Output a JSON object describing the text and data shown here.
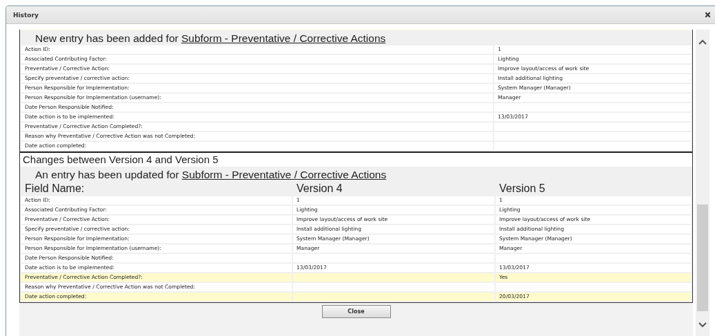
{
  "window": {
    "title": "History"
  },
  "sections": [
    {
      "kind": "added",
      "heading_prefix": "New entry has been added for ",
      "heading_link": "Subform - Preventative / Corrective Actions",
      "rows": [
        {
          "label": "Action ID:",
          "value": "1"
        },
        {
          "label": "Associated Contributing Factor:",
          "value": "Lighting"
        },
        {
          "label": "Preventative / Corrective Action:",
          "value": "Improve layout/access of work site"
        },
        {
          "label": "Specify preventative / corrective action:",
          "value": "Install additional lighting"
        },
        {
          "label": "Person Responsible for Implementation:",
          "value": "System Manager (Manager)"
        },
        {
          "label": "Person Responsible for Implementation (username):",
          "value": "Manager"
        },
        {
          "label": "Date Person Responsible Notified:",
          "value": ""
        },
        {
          "label": "Date action is to be implemented:",
          "value": "13/03/2017"
        },
        {
          "label": "Preventative / Corrective Action Completed?:",
          "value": ""
        },
        {
          "label": "Reason why Preventative / Corrective Action was not Completed:",
          "value": ""
        },
        {
          "label": "Date action completed:",
          "value": ""
        }
      ]
    },
    {
      "kind": "changes",
      "title": "Changes between Version 4 and Version 5",
      "heading_prefix": "An entry has been updated for ",
      "heading_link": "Subform - Preventative / Corrective Actions",
      "columns": [
        "Field Name:",
        "Version 4",
        "Version 5"
      ],
      "rows": [
        {
          "label": "Action ID:",
          "old": "1",
          "new": "1",
          "changed": false
        },
        {
          "label": "Associated Contributing Factor:",
          "old": "Lighting",
          "new": "Lighting",
          "changed": false
        },
        {
          "label": "Preventative / Corrective Action:",
          "old": "Improve layout/access of work site",
          "new": "Improve layout/access of work site",
          "changed": false
        },
        {
          "label": "Specify preventative / corrective action:",
          "old": "Install additional lighting",
          "new": "Install additional lighting",
          "changed": false
        },
        {
          "label": "Person Responsible for Implementation:",
          "old": "System Manager (Manager)",
          "new": "System Manager (Manager)",
          "changed": false
        },
        {
          "label": "Person Responsible for Implementation (username):",
          "old": "Manager",
          "new": "Manager",
          "changed": false
        },
        {
          "label": "Date Person Responsible Notified:",
          "old": "",
          "new": "",
          "changed": false
        },
        {
          "label": "Date action is to be implemented:",
          "old": "13/03/2017",
          "new": "13/03/2017",
          "changed": false
        },
        {
          "label": "Preventative / Corrective Action Completed?:",
          "old": "",
          "new": "Yes",
          "changed": true
        },
        {
          "label": "Reason why Preventative / Corrective Action was not Completed:",
          "old": "",
          "new": "",
          "changed": false
        },
        {
          "label": "Date action completed:",
          "old": "",
          "new": "20/03/2017",
          "changed": true
        }
      ]
    }
  ],
  "close_button": "Close"
}
